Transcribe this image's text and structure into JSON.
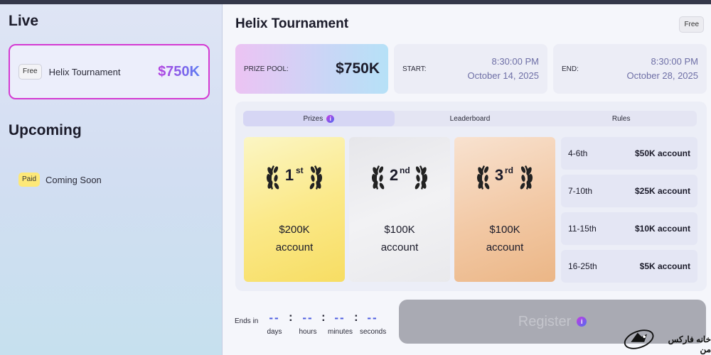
{
  "sidebar": {
    "live_heading": "Live",
    "live_card": {
      "badge": "Free",
      "name": "Helix Tournament",
      "amount": "$750K"
    },
    "upcoming_heading": "Upcoming",
    "upcoming_item": {
      "badge": "Paid",
      "name": "Coming Soon"
    }
  },
  "main": {
    "title": "Helix Tournament",
    "title_badge": "Free",
    "prize_pool": {
      "label": "PRIZE POOL:",
      "value": "$750K"
    },
    "start": {
      "label": "START:",
      "time": "8:30:00 PM",
      "date": "October 14, 2025"
    },
    "end": {
      "label": "END:",
      "time": "8:30:00 PM",
      "date": "October 28, 2025"
    },
    "tabs": [
      {
        "label": "Prizes",
        "active": true,
        "info": "i"
      },
      {
        "label": "Leaderboard",
        "active": false
      },
      {
        "label": "Rules",
        "active": false
      }
    ],
    "podium": [
      {
        "place": "1",
        "suffix": "st",
        "line1": "$200K",
        "line2": "account"
      },
      {
        "place": "2",
        "suffix": "nd",
        "line1": "$100K",
        "line2": "account"
      },
      {
        "place": "3",
        "suffix": "rd",
        "line1": "$100K",
        "line2": "account"
      }
    ],
    "ranks": [
      {
        "range": "4-6th",
        "prize": "$50K account"
      },
      {
        "range": "7-10th",
        "prize": "$25K account"
      },
      {
        "range": "11-15th",
        "prize": "$10K account"
      },
      {
        "range": "16-25th",
        "prize": "$5K account"
      }
    ],
    "countdown": {
      "label": "Ends in",
      "units": [
        {
          "value": "--",
          "label": "days"
        },
        {
          "value": "--",
          "label": "hours"
        },
        {
          "value": "--",
          "label": "minutes"
        },
        {
          "value": "--",
          "label": "seconds"
        }
      ],
      "separator": ":"
    },
    "register": {
      "label": "Register",
      "info": "i"
    }
  },
  "watermark": {
    "text": "خانه فارکس من"
  },
  "colors": {
    "accent_border": "#d43ad2",
    "gradient_start": "#b540e0",
    "gradient_end": "#5a7cf2",
    "countdown_digits": "#4d5de0",
    "register_bg": "#a9aab3"
  },
  "icons": [
    "laurel-wreath-icon",
    "info-icon",
    "fox-logo-icon"
  ]
}
